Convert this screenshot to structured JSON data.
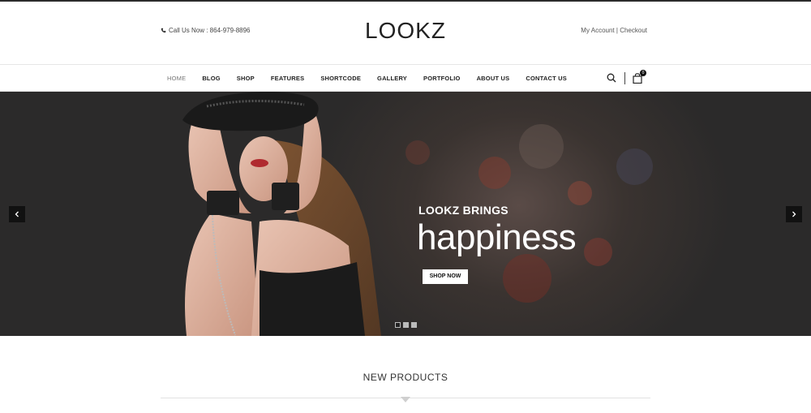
{
  "header": {
    "phone_text": "Call Us Now : 864-979-8896",
    "logo": "LOOKZ",
    "my_account": "My Account",
    "separator": "|",
    "checkout": "Checkout"
  },
  "nav": {
    "items": [
      {
        "label": "HOME",
        "active": true
      },
      {
        "label": "BLOG"
      },
      {
        "label": "SHOP"
      },
      {
        "label": "FEATURES"
      },
      {
        "label": "SHORTCODE"
      },
      {
        "label": "GALLERY"
      },
      {
        "label": "PORTFOLIO"
      },
      {
        "label": "ABOUT US"
      },
      {
        "label": "CONTACT US"
      }
    ],
    "cart_count": "0"
  },
  "hero": {
    "subtitle": "LOOKZ BRINGS",
    "title_light": "ha",
    "title_bold": "ppi",
    "title_rest": "ness",
    "button": "SHOP NOW",
    "slides": 3,
    "active_slide": 1
  },
  "section": {
    "title": "NEW PRODUCTS"
  },
  "colors": {
    "dark": "#111111",
    "hero_bg": "#2b2a2a"
  }
}
